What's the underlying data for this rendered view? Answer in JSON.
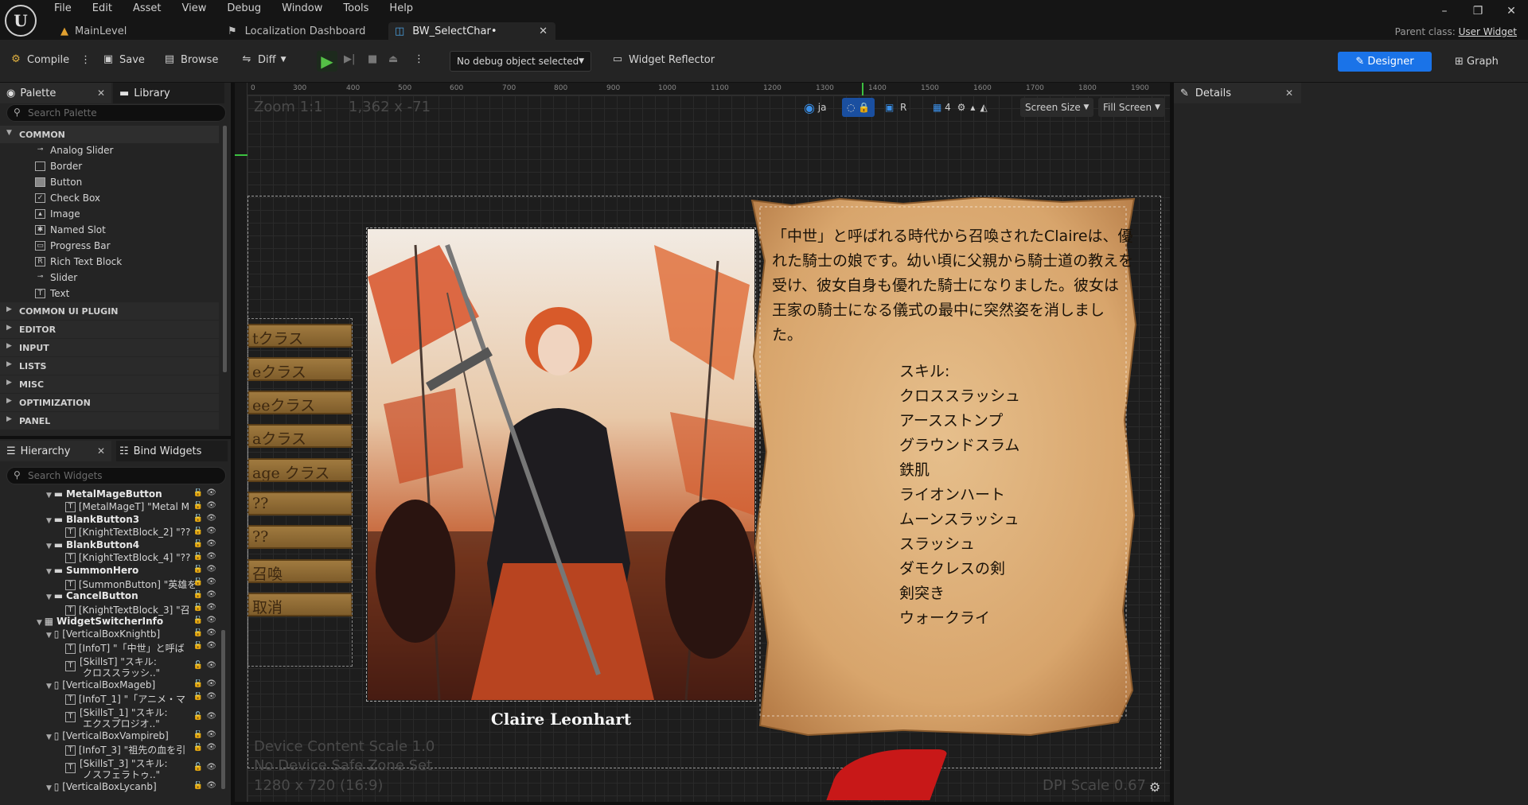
{
  "menu": [
    "File",
    "Edit",
    "Asset",
    "View",
    "Debug",
    "Window",
    "Tools",
    "Help"
  ],
  "tabs": [
    {
      "label": "MainLevel"
    },
    {
      "label": "Localization Dashboard"
    },
    {
      "label": "BW_SelectChar•"
    }
  ],
  "parent_class": {
    "label": "Parent class:",
    "value": "User Widget"
  },
  "toolbar": {
    "compile": "Compile",
    "save": "Save",
    "browse": "Browse",
    "diff": "Diff",
    "debug_select": "No debug object selected",
    "widget_reflector": "Widget Reflector",
    "designer": "Designer",
    "graph": "Graph"
  },
  "palette": {
    "title": "Palette",
    "library": "Library",
    "search_placeholder": "Search Palette",
    "common_label": "COMMON",
    "common_items": [
      "Analog Slider",
      "Border",
      "Button",
      "Check Box",
      "Image",
      "Named Slot",
      "Progress Bar",
      "Rich Text Block",
      "Slider",
      "Text"
    ],
    "categories": [
      "COMMON UI PLUGIN",
      "EDITOR",
      "INPUT",
      "LISTS",
      "MISC",
      "OPTIMIZATION",
      "PANEL"
    ]
  },
  "hierarchy": {
    "title": "Hierarchy",
    "bind_widgets": "Bind Widgets",
    "search_placeholder": "Search Widgets",
    "rows": [
      "MetalMageButton",
      "[MetalMageT] \"Metal M",
      "BlankButton3",
      "[KnightTextBlock_2] \"??",
      "BlankButton4",
      "[KnightTextBlock_4] \"??",
      "SummonHero",
      "[SummonButton] \"英雄を",
      "CancelButton",
      "[KnightTextBlock_3] \"召",
      "WidgetSwitcherInfo",
      "[VerticalBoxKnightb]",
      "[InfoT] \"「中世」と呼ば",
      "[SkillsT] \"スキル:",
      "クロススラッシ..\"",
      "[VerticalBoxMageb]",
      "[InfoT_1] \"「アニメ・マ",
      "[SkillsT_1] \"スキル:",
      "エクスプロジオ..\"",
      "[VerticalBoxVampireb]",
      "[InfoT_3] \"祖先の血を引",
      "[SkillsT_3] \"スキル:",
      "ノスフェラトゥ..\"",
      "[VerticalBoxLycanb]"
    ]
  },
  "canvas": {
    "zoom": "Zoom 1:1",
    "coords": "1,362 x -71",
    "lang": "ja",
    "r_label": "R",
    "grid_num": "4",
    "screen_size": "Screen Size",
    "fill_screen": "Fill Screen",
    "ruler_top": [
      "0",
      "300",
      "400",
      "500",
      "600",
      "700",
      "800",
      "900",
      "1000",
      "1100",
      "1200",
      "1300",
      "1400",
      "1500",
      "1600",
      "1700",
      "1800",
      "1900"
    ],
    "device_scale": "Device Content Scale 1.0",
    "safe_zone": "No Device Safe Zone Set",
    "resolution": "1280 x 720 (16:9)",
    "dpi": "DPI Scale 0.67"
  },
  "game": {
    "class_buttons": [
      "tクラス",
      "eクラス",
      "eeクラス",
      "aクラス",
      "age クラス",
      "??",
      "??",
      "召喚",
      "取消"
    ],
    "character_name": "Claire Leonhart",
    "description": "「中世」と呼ばれる時代から召喚されたClaireは、優れた騎士の娘です。幼い頃に父親から騎士道の教えを受け、彼女自身も優れた騎士になりました。彼女は王家の騎士になる儀式の最中に突然姿を消しました。",
    "skills_label": "スキル:",
    "skills": [
      "クロススラッシュ",
      "アースストンプ",
      "グラウンドスラム",
      "鉄肌",
      "ライオンハート",
      "ムーンスラッシュ",
      "スラッシュ",
      "ダモクレスの剣",
      "剣突き",
      "ウォークライ"
    ]
  },
  "details": {
    "title": "Details"
  }
}
